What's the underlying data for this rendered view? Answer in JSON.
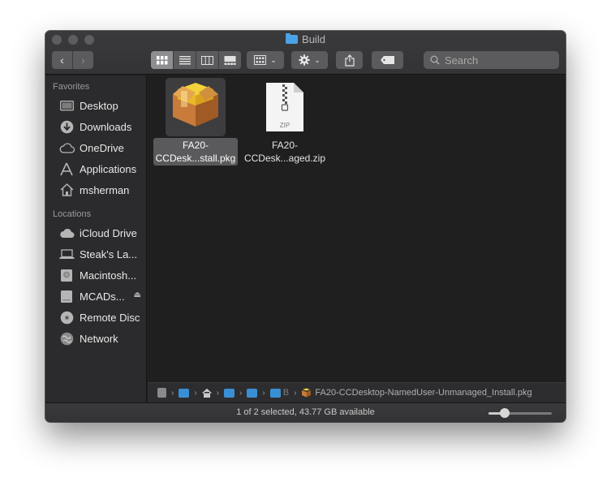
{
  "window": {
    "title": "Build"
  },
  "toolbar": {
    "back_glyph": "‹",
    "forward_glyph": "›",
    "view_modes": [
      {
        "name": "icon-view",
        "active": true
      },
      {
        "name": "list-view",
        "active": false
      },
      {
        "name": "column-view",
        "active": false
      },
      {
        "name": "gallery-view",
        "active": false
      }
    ],
    "search_placeholder": "Search"
  },
  "sidebar": {
    "favorites_heading": "Favorites",
    "favorites": [
      {
        "label": "Desktop",
        "icon": "desktop-icon"
      },
      {
        "label": "Downloads",
        "icon": "downloads-icon"
      },
      {
        "label": "OneDrive",
        "icon": "cloud-icon"
      },
      {
        "label": "Applications",
        "icon": "applications-icon"
      },
      {
        "label": "msherman",
        "icon": "home-icon"
      }
    ],
    "locations_heading": "Locations",
    "locations": [
      {
        "label": "iCloud Drive",
        "icon": "icloud-icon"
      },
      {
        "label": "Steak's La...",
        "icon": "laptop-icon"
      },
      {
        "label": "Macintosh...",
        "icon": "hard-drive-icon"
      },
      {
        "label": "MCADs...",
        "icon": "external-drive-icon",
        "eject": true
      },
      {
        "label": "Remote Disc",
        "icon": "disc-icon"
      },
      {
        "label": "Network",
        "icon": "network-icon"
      }
    ]
  },
  "files": [
    {
      "line1": "FA20-",
      "line2": "CCDesk...stall.pkg",
      "icon": "package-icon",
      "selected": true
    },
    {
      "line1": "FA20-",
      "line2": "CCDesk...aged.zip",
      "icon": "zip-file-icon",
      "selected": false,
      "badge": "ZIP"
    }
  ],
  "pathbar": {
    "truncated_letter": "B",
    "file": "FA20-CCDesktop-NamedUser-Unmanaged_Install.pkg"
  },
  "status": {
    "text": "1 of 2 selected, 43.77 GB available",
    "icon_size_fraction": 0.25
  },
  "colors": {
    "accent_folder": "#4aa3e6",
    "window_bg": "#1f1f1f",
    "sidebar_bg": "#2b2b2d"
  }
}
